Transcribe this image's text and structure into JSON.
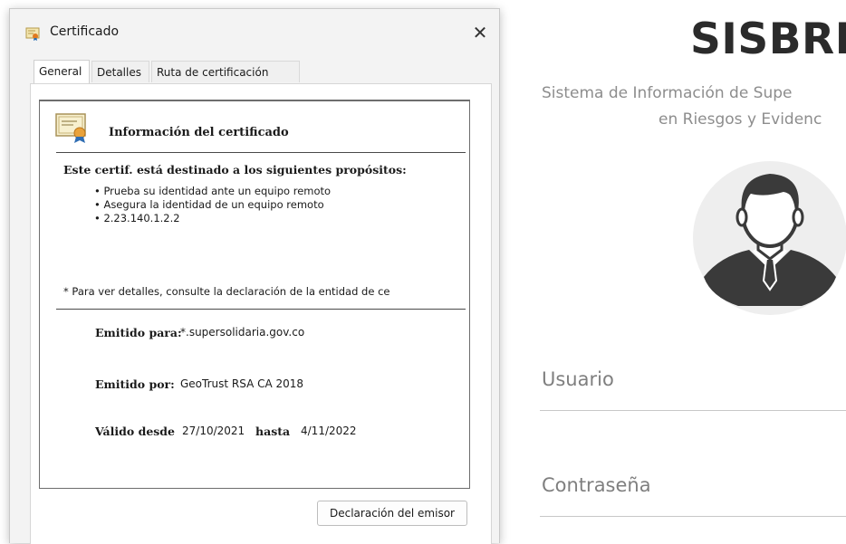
{
  "login": {
    "brand": "SISBRE",
    "subtitle_line1": "Sistema de Información de Supe",
    "subtitle_line2": "en Riesgos y Evidenc",
    "avatar_icon": "user-avatar-icon",
    "username_label": "Usuario",
    "password_label": "Contraseña"
  },
  "dialog": {
    "title": "Certificado",
    "close_glyph": "✕",
    "tabs": [
      {
        "label": "General",
        "active": true
      },
      {
        "label": "Detalles",
        "active": false
      },
      {
        "label": "Ruta de certificación",
        "active": false
      }
    ],
    "info": {
      "heading": "Información del certificado",
      "purposes_heading": "Este certif. está destinado a los siguientes propósitos:",
      "purposes": [
        "Prueba su identidad ante un equipo remoto",
        "Asegura la identidad de un equipo remoto",
        "2.23.140.1.2.2"
      ],
      "footnote": "* Para ver detalles, consulte la declaración de la entidad de ce",
      "issued_to_label": "Emitido para:",
      "issued_to_value": "*.supersolidaria.gov.co",
      "issued_by_label": "Emitido por:",
      "issued_by_value": "GeoTrust RSA CA 2018",
      "valid_from_label": "Válido desde",
      "valid_from_value": "27/10/2021",
      "valid_to_label": "hasta",
      "valid_to_value": "4/11/2022"
    },
    "issuer_statement_button": "Declaración del emisor"
  },
  "colors": {
    "brand_text": "#2b2b2b",
    "muted_text": "#8d8d8d",
    "avatar_fill": "#3a3a3a",
    "dialog_bg": "#f3f3f3"
  }
}
